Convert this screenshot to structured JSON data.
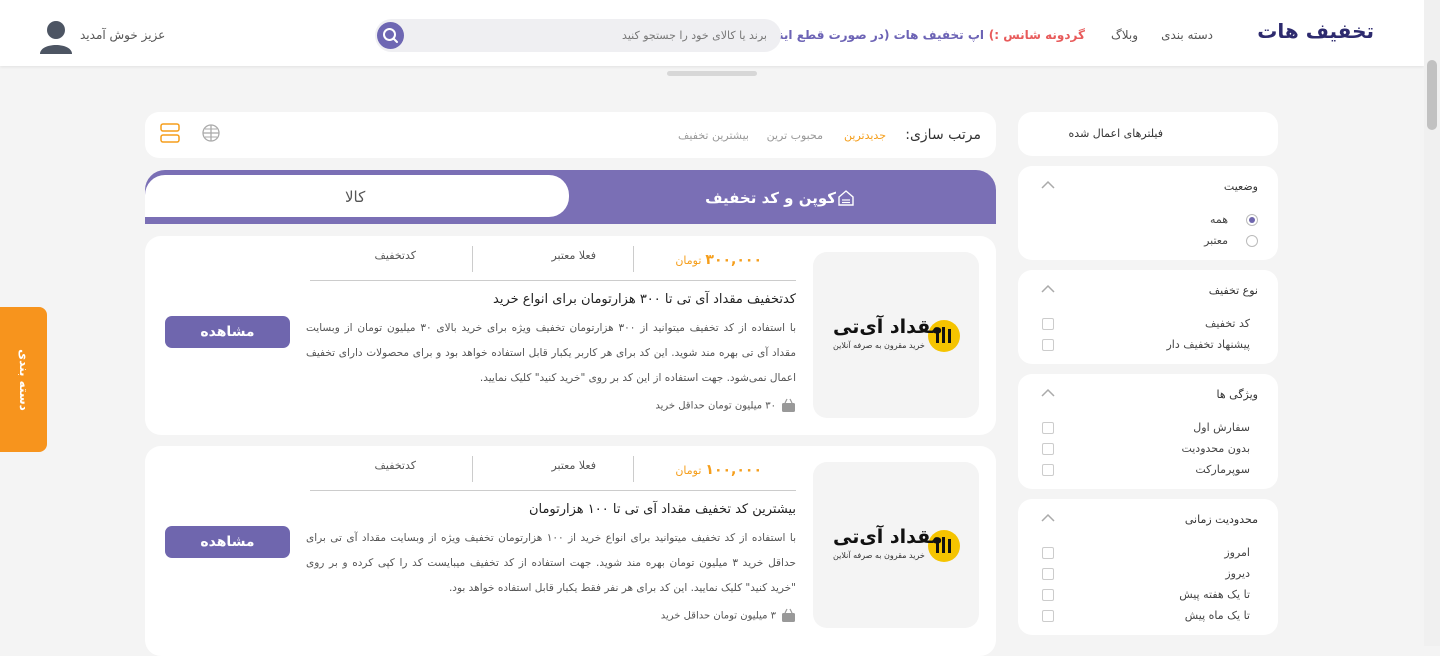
{
  "header": {
    "logo": "تخفیف هات",
    "nav": [
      "دسته بندی",
      "وبلاگ",
      "گردونه شانس :)",
      "اپ تخفیف هات (در صورت قطع اینترنت)"
    ],
    "search_placeholder": "برند یا کالای خود را جستجو کنید",
    "welcome": "عزیز خوش آمدید"
  },
  "side_tab": "دسته بندی",
  "sort": {
    "title": "مرتب سازی:",
    "options": [
      "جدیدترین",
      "محبوب ترین",
      "بیشترین تخفیف"
    ],
    "active": "جدیدترین"
  },
  "tabs": {
    "coupon": "کوپن و کد تخفیف",
    "goods": "کالا"
  },
  "cards": [
    {
      "brand": "مقداد آی‌تی",
      "brand_tagline": "خرید مقرون به صرفه آنلاین",
      "price": "۳۰۰,۰۰۰",
      "currency": "تومان",
      "status": "فعلا معتبر",
      "type": "کدتخفیف",
      "title": "کدتخفیف مقداد آی تی تا ۳۰۰ هزارتومان برای انواع خرید",
      "desc": "با استفاده از کد تخفیف میتوانید از ۳۰۰ هزارتومان تخفیف ویژه برای خرید بالای ۳۰ میلیون تومان از وبسایت مقداد آی تی بهره مند شوید. این کد برای هر کاربر یکبار قابل استفاده خواهد بود و برای محصولات دارای تخفیف اعمال نمی‌شود. جهت استفاده از این کد بر روی \"خرید کنید\" کلیک نمایید.",
      "min_buy": "۳۰ میلیون تومان حداقل خرید",
      "button": "مشاهده"
    },
    {
      "brand": "مقداد آی‌تی",
      "brand_tagline": "خرید مقرون به صرفه آنلاین",
      "price": "۱۰۰,۰۰۰",
      "currency": "تومان",
      "status": "فعلا معتبر",
      "type": "کدتخفیف",
      "title": "بیشترین کد تخفیف مقداد آی تی تا ۱۰۰ هزارتومان",
      "desc": "با استفاده از کد تخفیف میتوانید برای انواع خرید از ۱۰۰ هزارتومان تخفیف ویژه از وبسایت مقداد آی تی برای حداقل خرید ۳ میلیون تومان بهره مند شوید. جهت استفاده از کد تخفیف میبایست کد را کپی کرده و بر روی \"خرید کنید\" کلیک نمایید. این کد برای هر نفر فقط یکبار قابل استفاده خواهد بود.",
      "min_buy": "۳ میلیون تومان حداقل خرید",
      "button": "مشاهده"
    }
  ],
  "filters": {
    "applied": "فیلترهای اعمال شده",
    "groups": [
      {
        "title": "وضعیت",
        "options": [
          "همه",
          "معتبر"
        ],
        "selected": "همه"
      },
      {
        "title": "نوع تخفیف",
        "options": [
          "کد تخفیف",
          "پیشنهاد تخفیف دار"
        ]
      },
      {
        "title": "ویژگی ها",
        "options": [
          "سفارش اول",
          "بدون محدودیت",
          "سوپرمارکت"
        ]
      },
      {
        "title": "محدودیت زمانی",
        "options": [
          "امروز",
          "دیروز",
          "تا یک هفته پیش",
          "تا یک ماه پیش"
        ]
      }
    ]
  },
  "colors": {
    "accent": "#7a6fb5",
    "orange": "#f59e1b",
    "side_tab": "#f7941d"
  }
}
